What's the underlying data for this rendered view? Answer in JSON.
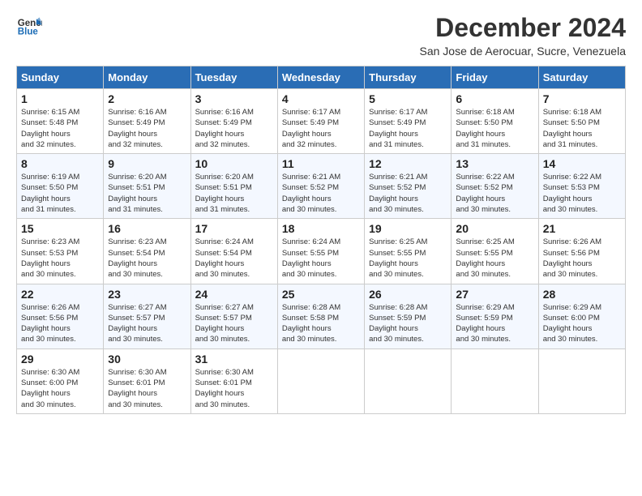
{
  "header": {
    "logo_line1": "General",
    "logo_line2": "Blue",
    "month": "December 2024",
    "location": "San Jose de Aerocuar, Sucre, Venezuela"
  },
  "weekdays": [
    "Sunday",
    "Monday",
    "Tuesday",
    "Wednesday",
    "Thursday",
    "Friday",
    "Saturday"
  ],
  "weeks": [
    [
      {
        "day": "1",
        "sunrise": "6:15 AM",
        "sunset": "5:48 PM",
        "daylight": "11 hours and 32 minutes."
      },
      {
        "day": "2",
        "sunrise": "6:16 AM",
        "sunset": "5:49 PM",
        "daylight": "11 hours and 32 minutes."
      },
      {
        "day": "3",
        "sunrise": "6:16 AM",
        "sunset": "5:49 PM",
        "daylight": "11 hours and 32 minutes."
      },
      {
        "day": "4",
        "sunrise": "6:17 AM",
        "sunset": "5:49 PM",
        "daylight": "11 hours and 32 minutes."
      },
      {
        "day": "5",
        "sunrise": "6:17 AM",
        "sunset": "5:49 PM",
        "daylight": "11 hours and 31 minutes."
      },
      {
        "day": "6",
        "sunrise": "6:18 AM",
        "sunset": "5:50 PM",
        "daylight": "11 hours and 31 minutes."
      },
      {
        "day": "7",
        "sunrise": "6:18 AM",
        "sunset": "5:50 PM",
        "daylight": "11 hours and 31 minutes."
      }
    ],
    [
      {
        "day": "8",
        "sunrise": "6:19 AM",
        "sunset": "5:50 PM",
        "daylight": "11 hours and 31 minutes."
      },
      {
        "day": "9",
        "sunrise": "6:20 AM",
        "sunset": "5:51 PM",
        "daylight": "11 hours and 31 minutes."
      },
      {
        "day": "10",
        "sunrise": "6:20 AM",
        "sunset": "5:51 PM",
        "daylight": "11 hours and 31 minutes."
      },
      {
        "day": "11",
        "sunrise": "6:21 AM",
        "sunset": "5:52 PM",
        "daylight": "11 hours and 30 minutes."
      },
      {
        "day": "12",
        "sunrise": "6:21 AM",
        "sunset": "5:52 PM",
        "daylight": "11 hours and 30 minutes."
      },
      {
        "day": "13",
        "sunrise": "6:22 AM",
        "sunset": "5:52 PM",
        "daylight": "11 hours and 30 minutes."
      },
      {
        "day": "14",
        "sunrise": "6:22 AM",
        "sunset": "5:53 PM",
        "daylight": "11 hours and 30 minutes."
      }
    ],
    [
      {
        "day": "15",
        "sunrise": "6:23 AM",
        "sunset": "5:53 PM",
        "daylight": "11 hours and 30 minutes."
      },
      {
        "day": "16",
        "sunrise": "6:23 AM",
        "sunset": "5:54 PM",
        "daylight": "11 hours and 30 minutes."
      },
      {
        "day": "17",
        "sunrise": "6:24 AM",
        "sunset": "5:54 PM",
        "daylight": "11 hours and 30 minutes."
      },
      {
        "day": "18",
        "sunrise": "6:24 AM",
        "sunset": "5:55 PM",
        "daylight": "11 hours and 30 minutes."
      },
      {
        "day": "19",
        "sunrise": "6:25 AM",
        "sunset": "5:55 PM",
        "daylight": "11 hours and 30 minutes."
      },
      {
        "day": "20",
        "sunrise": "6:25 AM",
        "sunset": "5:55 PM",
        "daylight": "11 hours and 30 minutes."
      },
      {
        "day": "21",
        "sunrise": "6:26 AM",
        "sunset": "5:56 PM",
        "daylight": "11 hours and 30 minutes."
      }
    ],
    [
      {
        "day": "22",
        "sunrise": "6:26 AM",
        "sunset": "5:56 PM",
        "daylight": "11 hours and 30 minutes."
      },
      {
        "day": "23",
        "sunrise": "6:27 AM",
        "sunset": "5:57 PM",
        "daylight": "11 hours and 30 minutes."
      },
      {
        "day": "24",
        "sunrise": "6:27 AM",
        "sunset": "5:57 PM",
        "daylight": "11 hours and 30 minutes."
      },
      {
        "day": "25",
        "sunrise": "6:28 AM",
        "sunset": "5:58 PM",
        "daylight": "11 hours and 30 minutes."
      },
      {
        "day": "26",
        "sunrise": "6:28 AM",
        "sunset": "5:59 PM",
        "daylight": "11 hours and 30 minutes."
      },
      {
        "day": "27",
        "sunrise": "6:29 AM",
        "sunset": "5:59 PM",
        "daylight": "11 hours and 30 minutes."
      },
      {
        "day": "28",
        "sunrise": "6:29 AM",
        "sunset": "6:00 PM",
        "daylight": "11 hours and 30 minutes."
      }
    ],
    [
      {
        "day": "29",
        "sunrise": "6:30 AM",
        "sunset": "6:00 PM",
        "daylight": "11 hours and 30 minutes."
      },
      {
        "day": "30",
        "sunrise": "6:30 AM",
        "sunset": "6:01 PM",
        "daylight": "11 hours and 30 minutes."
      },
      {
        "day": "31",
        "sunrise": "6:30 AM",
        "sunset": "6:01 PM",
        "daylight": "11 hours and 30 minutes."
      },
      null,
      null,
      null,
      null
    ]
  ]
}
